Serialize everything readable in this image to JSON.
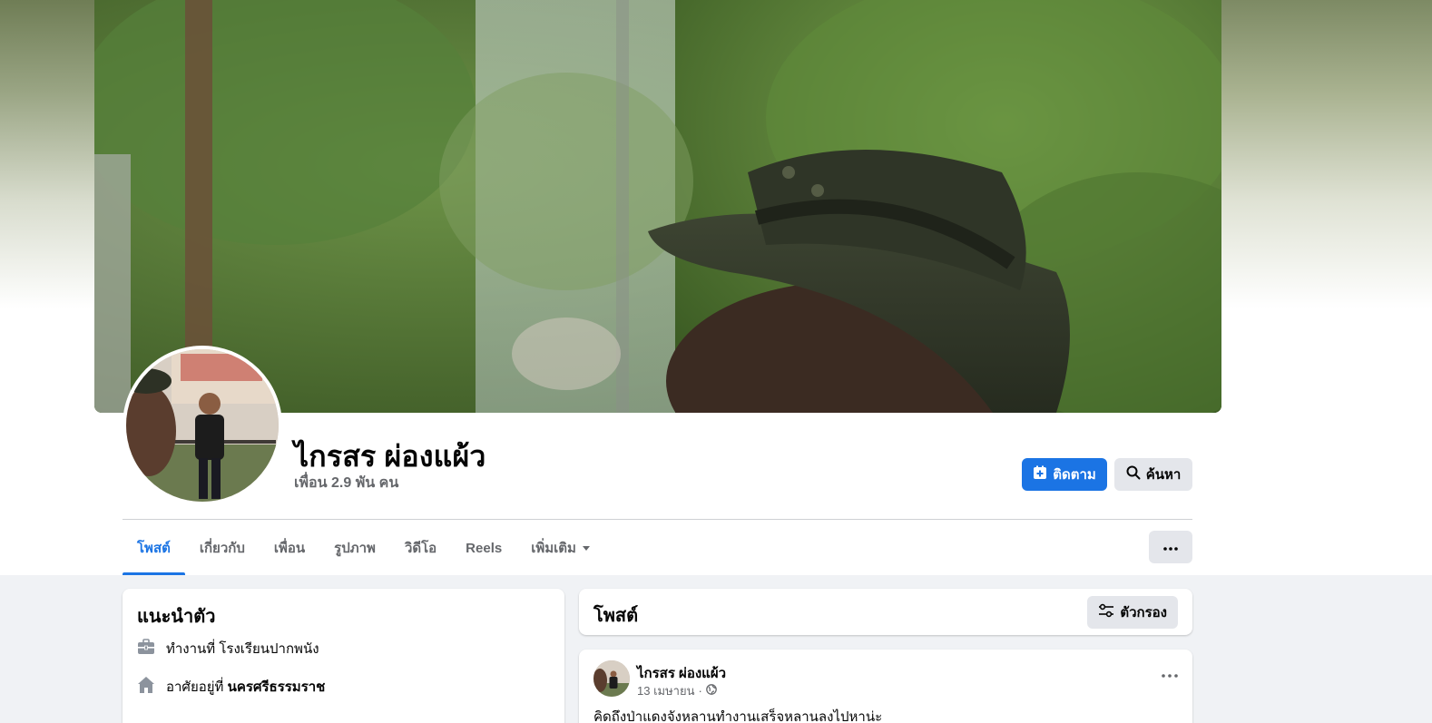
{
  "profile": {
    "name": "ไกรสร ผ่องแผ้ว",
    "friends": "เพื่อน 2.9 พัน คน"
  },
  "actions": {
    "follow_label": "ติดตาม",
    "search_label": "ค้นหา"
  },
  "tabs": [
    {
      "label": "โพสต์"
    },
    {
      "label": "เกี่ยวกับ"
    },
    {
      "label": "เพื่อน"
    },
    {
      "label": "รูปภาพ"
    },
    {
      "label": "วิดีโอ"
    },
    {
      "label": "Reels"
    },
    {
      "label": "เพิ่มเติม"
    }
  ],
  "intro": {
    "title": "แนะนำตัว",
    "work_label": "ทำงานที่ โรงเรียนปากพนัง",
    "home_prefix": "อาศัยอยู่ที่ ",
    "home_place": "นครศรีธรรมราช"
  },
  "posts": {
    "title": "โพสต์",
    "filter_label": "ตัวกรอง",
    "items": [
      {
        "author": "ไกรสร ผ่องแผ้ว",
        "date": "13 เมษายน",
        "separator": "·",
        "text": "คิดถึงป่าแดงจังหลานทำงานเสร็จหลานลงไปหาน่ะ"
      }
    ]
  },
  "colors": {
    "accent": "#1b74e4",
    "muted_text": "#65676b",
    "button_grey": "#e4e6eb",
    "page_bg": "#f0f2f5"
  },
  "icons": {
    "follow": "follow-plus-icon",
    "search": "search-icon",
    "dropdown": "caret-down-icon",
    "more": "more-dots-icon",
    "filter": "filter-sliders-icon",
    "work": "briefcase-icon",
    "home": "home-icon",
    "privacy": "globe-icon"
  }
}
